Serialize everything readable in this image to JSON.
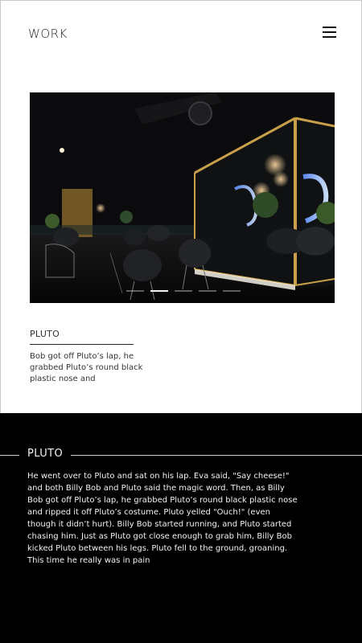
{
  "header": {
    "title": "WORK",
    "menu_icon": "hamburger-menu-icon"
  },
  "hero": {
    "image_description": "dark restaurant interior with gold-framed glass room and warm pendant lights",
    "slides_count": 5,
    "active_slide": 2
  },
  "card": {
    "title": "PLUTO",
    "excerpt": "Bob got off Pluto’s lap, he grabbed Pluto’s round black plastic nose and"
  },
  "detail": {
    "title": "PLUTO",
    "body": "He went over to Pluto and sat on his lap. Eva said, \"Say cheese!\" and both Billy Bob and Pluto said the magic word. Then, as Billy Bob got off Pluto’s lap, he grabbed Pluto’s round black plastic nose and ripped it off Pluto’s costume. Pluto yelled \"Ouch!\" (even though it didn’t hurt). Billy Bob started running, and Pluto started chasing him. Just as Pluto got close enough to grab him, Billy Bob kicked Pluto between his legs. Pluto fell to the ground, groaning. This time he really was in pain"
  },
  "colors": {
    "top_background": "#ffffff",
    "bottom_background": "#000000",
    "accent_gold": "#c8a04a"
  }
}
